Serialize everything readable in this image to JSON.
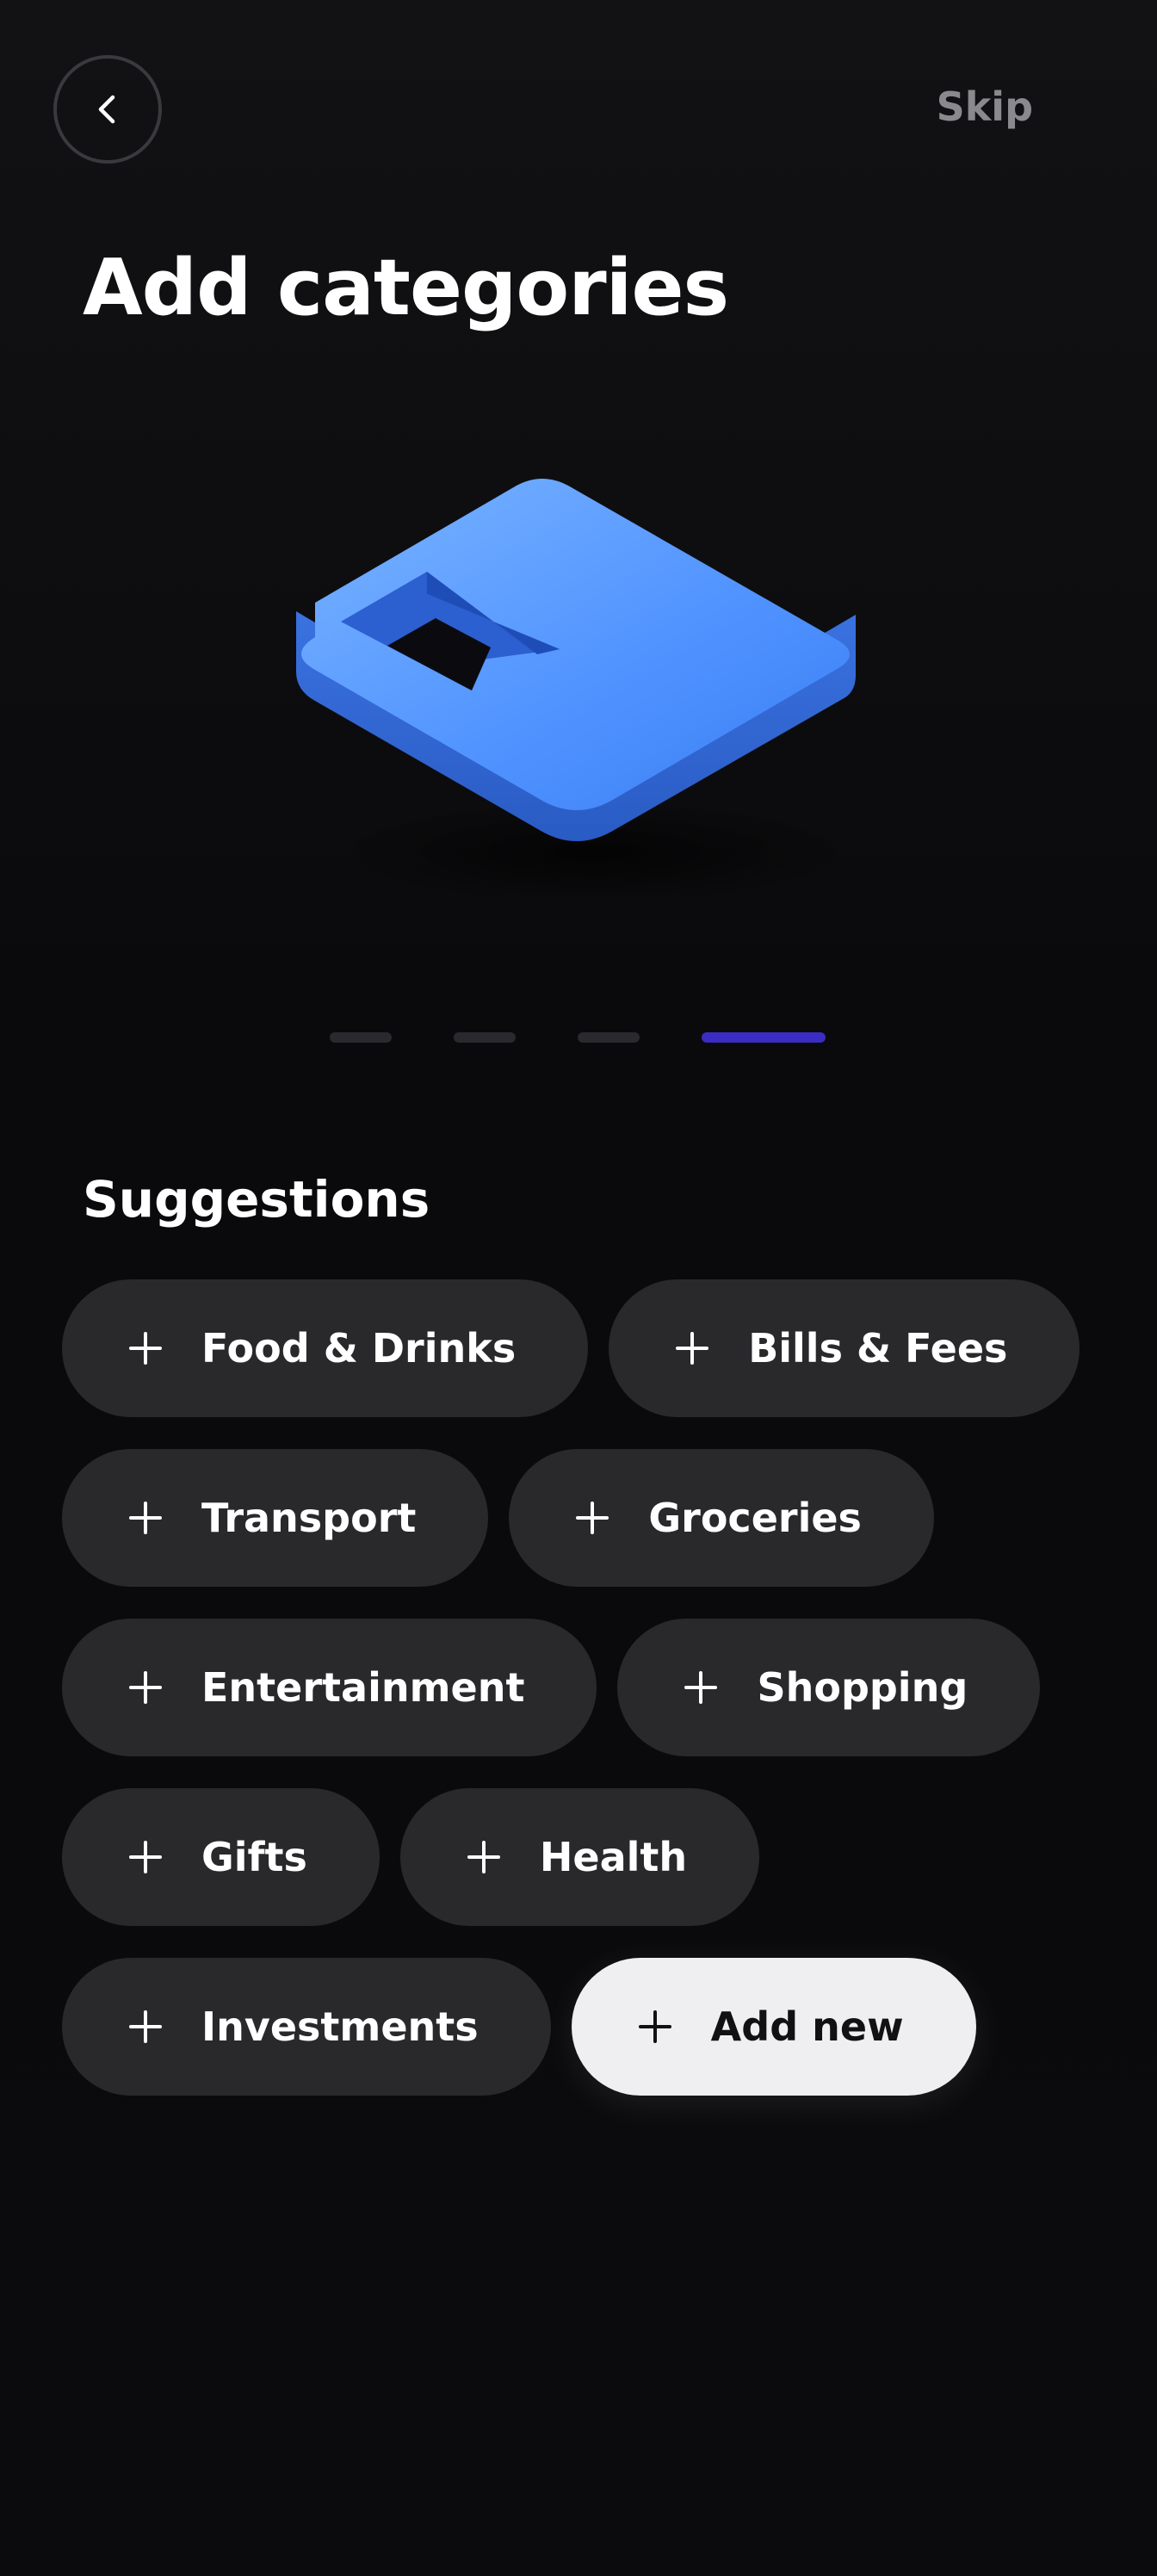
{
  "header": {
    "back_icon": "chevron-left-icon",
    "skip_label": "Skip"
  },
  "title": "Add categories",
  "illustration": {
    "icon": "folder-tray-3d-icon",
    "color": "#4a8cf7"
  },
  "pager": {
    "total": 4,
    "active_index": 3,
    "active_color": "#3b2cc4"
  },
  "suggestions": {
    "title": "Suggestions",
    "chip_icon": "plus-icon",
    "items": [
      {
        "label": "Food & Drinks"
      },
      {
        "label": "Bills & Fees"
      },
      {
        "label": "Transport"
      },
      {
        "label": "Groceries"
      },
      {
        "label": "Entertainment"
      },
      {
        "label": "Shopping"
      },
      {
        "label": "Gifts"
      },
      {
        "label": "Health"
      },
      {
        "label": "Investments"
      }
    ],
    "add_new_label": "Add new"
  }
}
